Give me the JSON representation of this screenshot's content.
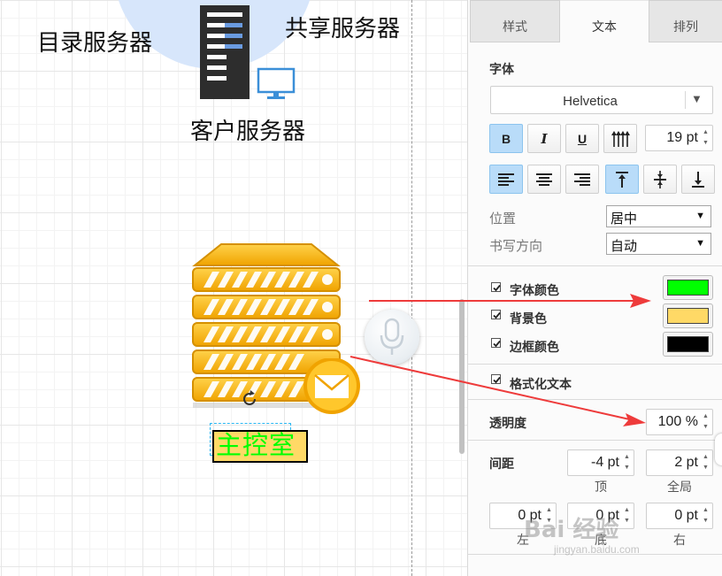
{
  "canvas": {
    "labels": {
      "directory_server": "目录服务器",
      "shared_server": "共享服务器",
      "client_server": "客户服务器"
    },
    "selected_shape_text": "主控室"
  },
  "panel": {
    "tabs": [
      {
        "label": "样式",
        "active": false
      },
      {
        "label": "文本",
        "active": true
      },
      {
        "label": "排列",
        "active": false
      }
    ],
    "font": {
      "section_title": "字体",
      "family": "Helvetica",
      "size": "19 pt",
      "bold": true,
      "italic": false,
      "underline": false,
      "align": "left",
      "valign": "top"
    },
    "position": {
      "label": "位置",
      "value": "居中",
      "options": [
        "居中"
      ]
    },
    "direction": {
      "label": "书写方向",
      "value": "自动",
      "options": [
        "自动"
      ]
    },
    "colors": {
      "font_color": {
        "label": "字体颜色",
        "checked": true,
        "hex": "#00ff00"
      },
      "background": {
        "label": "背景色",
        "checked": true,
        "hex": "#ffd966"
      },
      "border": {
        "label": "边框颜色",
        "checked": true,
        "hex": "#000000"
      }
    },
    "formatted_text": {
      "label": "格式化文本",
      "checked": true
    },
    "opacity": {
      "label": "透明度",
      "value": "100 %"
    },
    "spacing": {
      "label": "间距",
      "top": {
        "value": "-4 pt",
        "caption": "顶"
      },
      "global": {
        "value": "2 pt",
        "caption": "全局"
      },
      "left": {
        "value": "0 pt",
        "caption": "左"
      },
      "bottom": {
        "value": "0 pt",
        "caption": "底"
      },
      "right": {
        "value": "0 pt",
        "caption": "右"
      }
    }
  },
  "annotations": {
    "arrow_color": "#ee3b3b"
  },
  "watermark": {
    "logo_text": "Bai 经验",
    "url": "jingyan.baidu.com"
  }
}
